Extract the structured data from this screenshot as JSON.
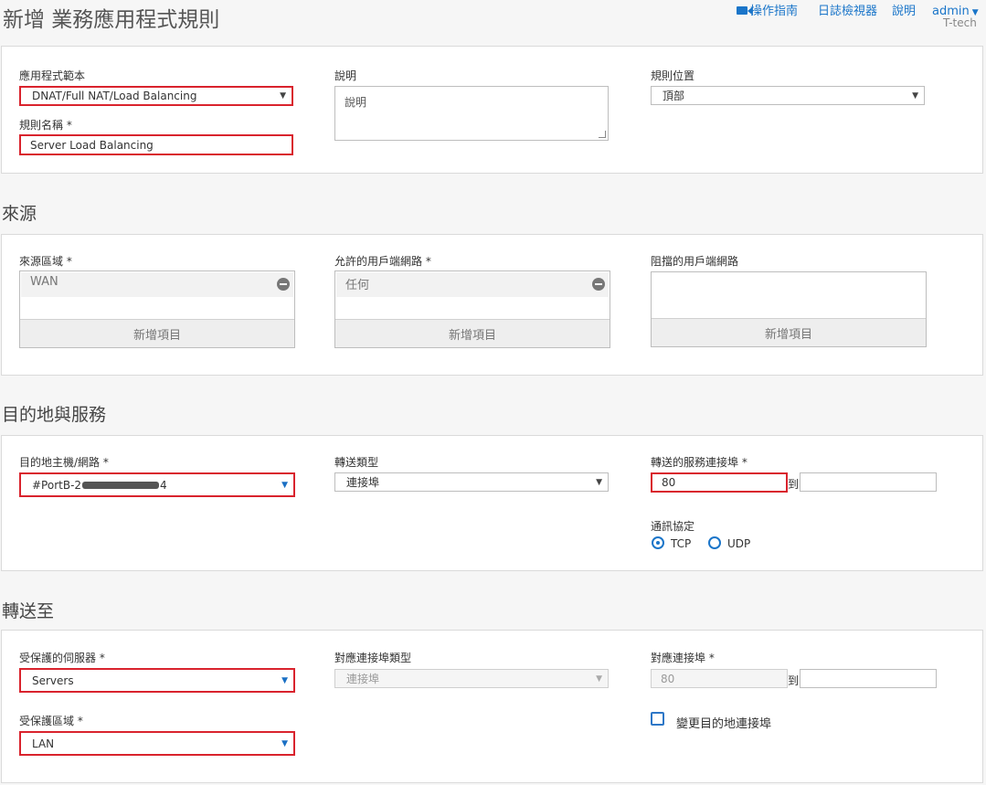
{
  "header": {
    "title": "新增 業務應用程式規則",
    "nav": {
      "guide": "操作指南",
      "log_viewer": "日誌檢視器",
      "help": "說明",
      "user": "admin"
    },
    "tenant": "T-tech"
  },
  "general": {
    "template_label": "應用程式範本",
    "template_value": "DNAT/Full NAT/Load Balancing",
    "rule_name_label": "規則名稱 *",
    "rule_name_value": "Server Load Balancing",
    "description_label": "說明",
    "description_value": "說明",
    "position_label": "規則位置",
    "position_value": "頂部"
  },
  "source": {
    "section_title": "來源",
    "zones_label": "來源區域 *",
    "zones_items": [
      "WAN"
    ],
    "allowed_label": "允許的用戶端網路 *",
    "allowed_items": [
      "任何"
    ],
    "blocked_label": "阻擋的用戶端網路",
    "add_item": "新增項目"
  },
  "destination": {
    "section_title": "目的地與服務",
    "host_label": "目的地主機/網路 *",
    "host_value_prefix": "#PortB-2",
    "host_value_suffix": "4",
    "forward_type_label": "轉送類型",
    "forward_type_value": "連接埠",
    "service_port_label": "轉送的服務連接埠 *",
    "service_port_from": "80",
    "to_label": "到",
    "service_port_to": "",
    "protocol_label": "通訊協定",
    "protocol_tcp": "TCP",
    "protocol_udp": "UDP"
  },
  "forward": {
    "section_title": "轉送至",
    "server_label": "受保護的伺服器 *",
    "server_value": "Servers",
    "mapped_type_label": "對應連接埠類型",
    "mapped_type_value": "連接埠",
    "mapped_port_label": "對應連接埠 *",
    "mapped_port_from": "80",
    "to_label": "到",
    "mapped_port_to": "",
    "zone_label": "受保護區域 *",
    "zone_value": "LAN",
    "change_dest_port_label": "變更目的地連接埠"
  },
  "colors": {
    "accent": "#1a75c9",
    "highlight": "#d9232d"
  }
}
